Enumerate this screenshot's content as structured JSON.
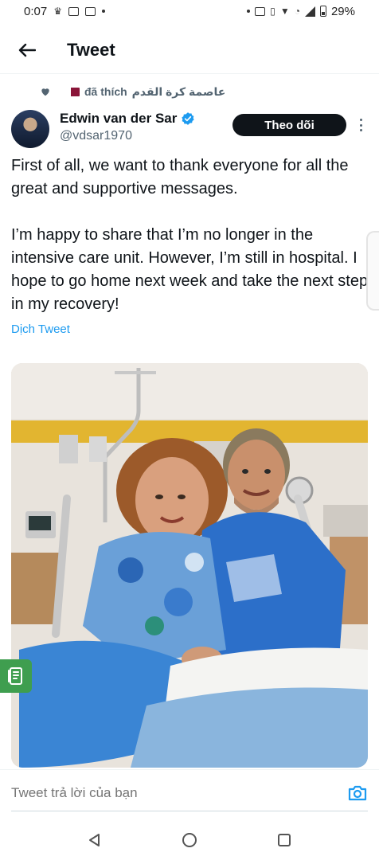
{
  "status_bar": {
    "time": "0:07",
    "battery": "29%"
  },
  "header": {
    "title": "Tweet"
  },
  "social_context": {
    "source": "عاصمة كرة القدم",
    "action": "đã thích"
  },
  "author": {
    "name": "Edwin van der Sar",
    "handle": "@vdsar1970",
    "follow_label": "Theo dõi"
  },
  "tweet": {
    "paragraph_1": "First of all, we want to thank everyone for all the great and supportive messages.",
    "paragraph_2": "I’m happy to share that I’m no longer in the intensive care unit. However, I’m still in hospital. I hope to go home next week and take the next step in my recovery!",
    "translate_label": "Dịch Tweet"
  },
  "reply": {
    "placeholder": "Tweet trả lời của bạn"
  },
  "colors": {
    "accent": "#1d9bf0",
    "text": "#0f1419",
    "muted": "#536471",
    "follow_bg": "#0f1419",
    "note_button": "#3f9e4f"
  },
  "icons": {
    "back": "arrow-left-icon",
    "liked": "heart-icon",
    "verified": "verified-badge-icon",
    "more": "more-vertical-icon",
    "camera": "camera-icon",
    "note": "note-icon",
    "nav_back": "triangle-back-icon",
    "nav_home": "circle-home-icon",
    "nav_recents": "square-recents-icon"
  }
}
